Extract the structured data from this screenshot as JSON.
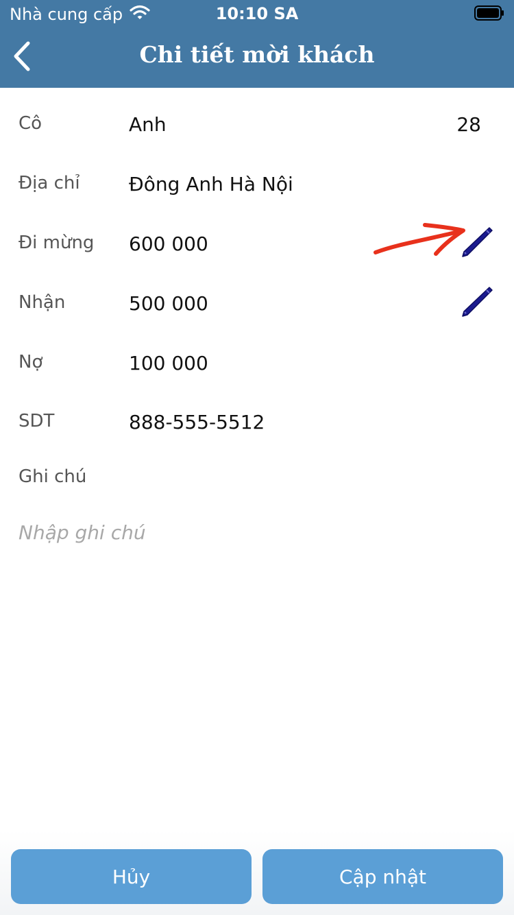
{
  "status_bar": {
    "carrier": "Nhà cung cấp",
    "time": "10:10 SA",
    "wifi_icon": "wifi-icon",
    "battery_icon": "battery-icon"
  },
  "header": {
    "title": "Chi tiết mời khách",
    "back_icon": "chevron-left-icon",
    "background": "#4479a4"
  },
  "fields": {
    "title_row": {
      "label": "Cô",
      "value": "Anh",
      "extra": "28"
    },
    "address": {
      "label": "Địa chỉ",
      "value": "Đông Anh Hà Nội"
    },
    "gift_given": {
      "label": "Đi mừng",
      "value": "600 000",
      "edit_icon": "pencil-icon"
    },
    "gift_received": {
      "label": "Nhận",
      "value": "500 000",
      "edit_icon": "pencil-icon"
    },
    "debt": {
      "label": "Nợ",
      "value": "100 000"
    },
    "phone": {
      "label": "SDT",
      "value": "888-555-5512"
    },
    "note": {
      "label": "Ghi chú",
      "placeholder": "Nhập ghi chú",
      "value": ""
    }
  },
  "annotation": {
    "icon": "red-arrow-annotation",
    "color": "#e8311c"
  },
  "footer": {
    "cancel_label": "Hủy",
    "update_label": "Cập nhật",
    "button_color": "#5b9fd6"
  }
}
